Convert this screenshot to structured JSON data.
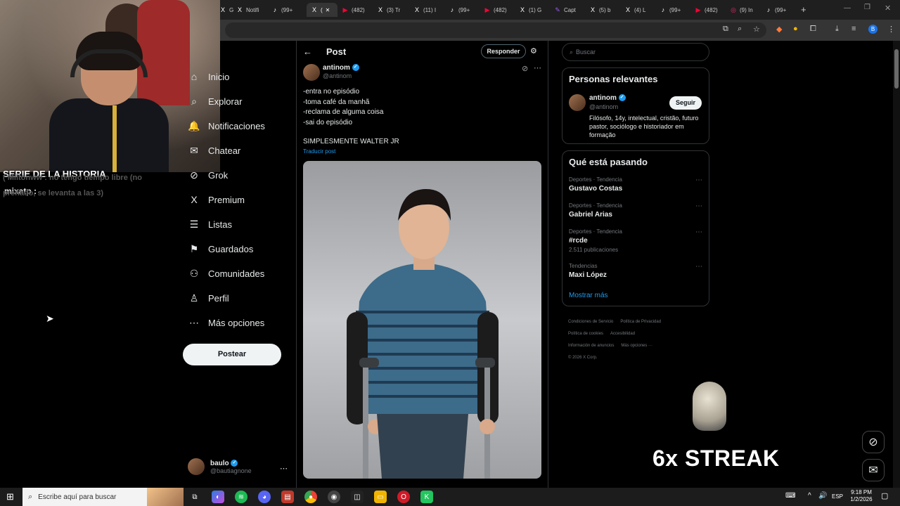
{
  "browser": {
    "tabs": [
      {
        "label": "G",
        "icon": "x-icon",
        "color": "#ffffff"
      },
      {
        "label": "Notifi",
        "icon": "x-icon",
        "color": "#ffffff"
      },
      {
        "label": "(99+",
        "icon": "tiktok-icon",
        "color": "#ffffff"
      },
      {
        "label": "(",
        "icon": "x-icon",
        "color": "#ffffff",
        "active": true
      },
      {
        "label": "(482)",
        "icon": "youtube-icon",
        "color": "#ff0033"
      },
      {
        "label": "(3) Tr",
        "icon": "x-icon",
        "color": "#ffffff"
      },
      {
        "label": "(11) I",
        "icon": "x-icon",
        "color": "#ffffff"
      },
      {
        "label": "(99+",
        "icon": "tiktok-icon",
        "color": "#ffffff"
      },
      {
        "label": "(482)",
        "icon": "youtube-icon",
        "color": "#ff0033"
      },
      {
        "label": "(1) G",
        "icon": "x-icon",
        "color": "#ffffff"
      },
      {
        "label": "Capt",
        "icon": "pen-icon",
        "color": "#9b59f5"
      },
      {
        "label": "(5) b",
        "icon": "x-icon",
        "color": "#ffffff"
      },
      {
        "label": "(4) L",
        "icon": "x-icon",
        "color": "#ffffff"
      },
      {
        "label": "(99+",
        "icon": "tiktok-icon",
        "color": "#ffffff"
      },
      {
        "label": "(482)",
        "icon": "youtube-icon",
        "color": "#ff0033"
      },
      {
        "label": "(9) In",
        "icon": "instagram-icon",
        "color": "#e1306c"
      },
      {
        "label": "(99+",
        "icon": "tiktok-icon",
        "color": "#ffffff"
      }
    ],
    "new_tab": "+",
    "profile_initial": "B"
  },
  "stream_overlay": {
    "title": "SERIE DE LA HISTORIA",
    "chat_line_1": "( Miltonww : no tengo tiempo libre (no",
    "chat_line_2": "preñado, se levanta a las 3)",
    "user": "mixatp :",
    "streak": "6x STREAK"
  },
  "nav": {
    "items": [
      {
        "label": "Inicio",
        "icon": "home-icon",
        "glyph": "⌂"
      },
      {
        "label": "Explorar",
        "icon": "search-icon",
        "glyph": "⌕"
      },
      {
        "label": "Notificaciones",
        "icon": "bell-icon",
        "glyph": "🔔"
      },
      {
        "label": "Chatear",
        "icon": "chat-icon",
        "glyph": "✉"
      },
      {
        "label": "Grok",
        "icon": "grok-icon",
        "glyph": "⊘"
      },
      {
        "label": "Premium",
        "icon": "x-icon",
        "glyph": "X"
      },
      {
        "label": "Listas",
        "icon": "list-icon",
        "glyph": "☰"
      },
      {
        "label": "Guardados",
        "icon": "bookmark-icon",
        "glyph": "⚑"
      },
      {
        "label": "Comunidades",
        "icon": "community-icon",
        "glyph": "⚇"
      },
      {
        "label": "Perfil",
        "icon": "person-icon",
        "glyph": "♙"
      },
      {
        "label": "Más opciones",
        "icon": "more-icon",
        "glyph": "⋯"
      }
    ],
    "post_button": "Postear",
    "me": {
      "name": "baulo",
      "handle": "@bautiagnone"
    }
  },
  "post": {
    "header_title": "Post",
    "reply_button": "Responder",
    "author_name": "antinom",
    "author_handle": "@antinom",
    "lines": [
      "-entra no episódio",
      "-toma café da manhã",
      "-reclama de alguma coisa",
      "-sai do episódio"
    ],
    "caption": "SIMPLESMENTE WALTER JR",
    "translate": "Traducir post"
  },
  "sidebar": {
    "search_placeholder": "Buscar",
    "relevant": {
      "title": "Personas relevantes",
      "name": "antinom",
      "handle": "@antinom",
      "follow": "Seguir",
      "bio": "Filósofo, 14y, intelectual, cristão, futuro pastor, sociólogo e historiador em formação"
    },
    "trends": {
      "title": "Qué está pasando",
      "items": [
        {
          "category": "Deportes · Tendencia",
          "name": "Gustavo Costas",
          "count": ""
        },
        {
          "category": "Deportes · Tendencia",
          "name": "Gabriel Arias",
          "count": ""
        },
        {
          "category": "Deportes · Tendencia",
          "name": "#rcde",
          "count": "2.511 publicaciones"
        },
        {
          "category": "Tendencias",
          "name": "Maxi López",
          "count": ""
        }
      ],
      "show_more": "Mostrar más"
    },
    "footer": {
      "links": [
        "Condiciones de Servicio",
        "Política de Privacidad",
        "Política de cookies",
        "Accesibilidad",
        "Información de anuncios",
        "Más opciones ···"
      ],
      "copyright": "© 2026 X Corp."
    }
  },
  "taskbar": {
    "search_placeholder": "Escribe aquí para buscar",
    "language": "ESP",
    "time": "9:18 PM",
    "date": "1/2/2026"
  },
  "colors": {
    "accent": "#1d9bf0",
    "bg": "#000000",
    "border": "#2f3336"
  }
}
